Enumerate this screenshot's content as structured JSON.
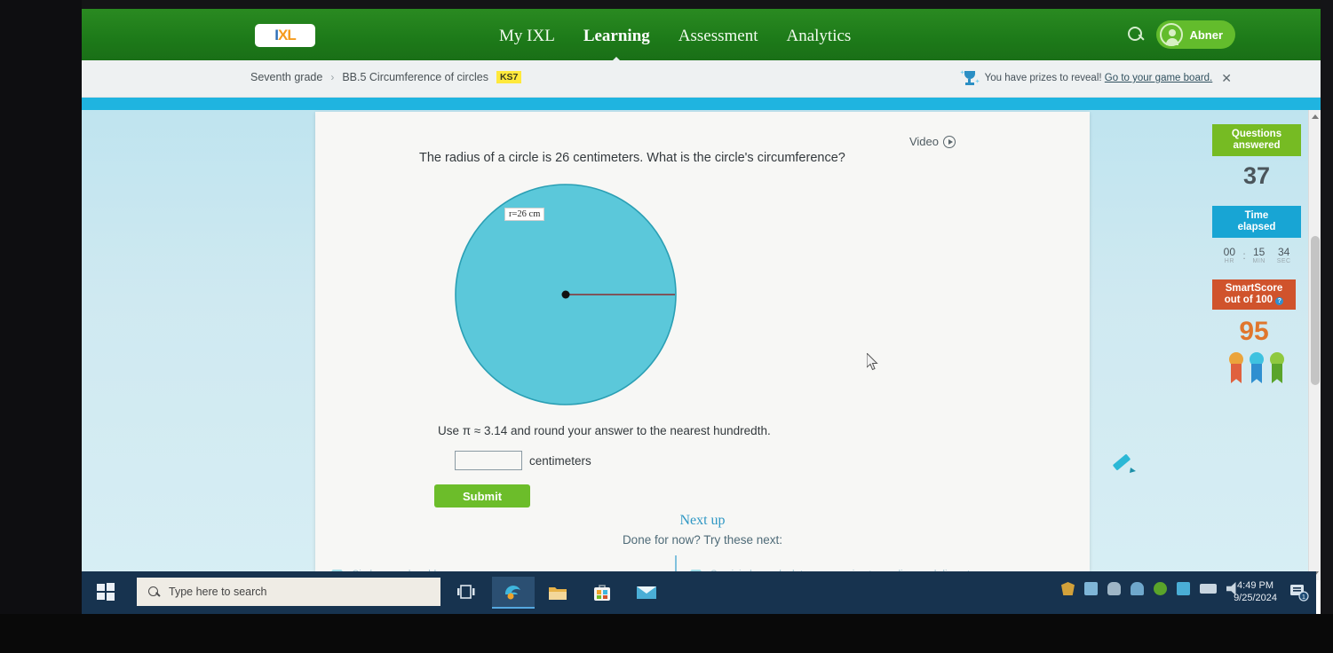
{
  "monitor": {
    "faint_top_text": ""
  },
  "header": {
    "logo": {
      "prefix": "I",
      "mid": "X",
      "suffix": "L"
    },
    "nav": [
      {
        "label": "My IXL",
        "active": false
      },
      {
        "label": "Learning",
        "active": true
      },
      {
        "label": "Assessment",
        "active": false
      },
      {
        "label": "Analytics",
        "active": false
      }
    ],
    "search_icon": "search-icon",
    "user": {
      "name": "Abner"
    },
    "colors": {
      "green": "#1d7a19",
      "pill_green": "#63bc2c"
    }
  },
  "breadcrumb": {
    "grade": "Seventh grade",
    "separator": "›",
    "skill": "BB.5 Circumference of circles",
    "badge": "KS7"
  },
  "prize_banner": {
    "icon": "trophy-icon",
    "message": "You have prizes to reveal!",
    "link": "Go to your game board.",
    "close": "✕"
  },
  "question": {
    "video_label": "Video",
    "prompt": "The radius of a circle is 26 centimeters. What is the circle's circumference?",
    "figure": {
      "type": "circle",
      "radius_label": "r=26 cm",
      "radius_value": 26,
      "unit": "cm",
      "fill": "#5bc8da",
      "stroke": "#2a9fb4",
      "radius_line_color": "#8a2f2f"
    },
    "hint": "Use π ≈ 3.14 and round your answer to the nearest hundredth.",
    "answer_value": "",
    "answer_placeholder": "",
    "answer_unit": "centimeters",
    "submit_label": "Submit",
    "scratchpad_icon": "pencil-icon"
  },
  "next_up": {
    "title": "Next up",
    "subtitle": "Done for now? Try these next:",
    "links": [
      {
        "icon": "gem-icon",
        "label": "Circles: word problems"
      },
      {
        "icon": "gem-icon",
        "label": "Semicircles: calculate area, perimeter, radius, and diameter"
      }
    ]
  },
  "stats": {
    "questions": {
      "title_line1": "Questions",
      "title_line2": "answered",
      "value": "37",
      "color": "#76bb23"
    },
    "time": {
      "title_line1": "Time",
      "title_line2": "elapsed",
      "color": "#18a5d4",
      "hours": "00",
      "minutes": "15",
      "seconds": "34",
      "label_hr": "HR",
      "label_min": "MIN",
      "label_sec": "SEC",
      "colon": ":"
    },
    "smartscore": {
      "title_line1": "SmartScore",
      "title_line2": "out of 100",
      "info_icon": "info-icon",
      "value": "95",
      "color": "#d0532c",
      "value_color": "#e0762d"
    },
    "ribbons": [
      "orange",
      "blue",
      "green"
    ]
  },
  "taskbar": {
    "start_icon": "windows-start-icon",
    "search_placeholder": "Type here to search",
    "task_view_icon": "task-view-icon",
    "apps": [
      {
        "name": "edge-icon",
        "active": true
      },
      {
        "name": "file-explorer-icon",
        "active": false
      },
      {
        "name": "microsoft-store-icon",
        "active": false
      },
      {
        "name": "mail-icon",
        "active": false
      }
    ],
    "tray_icons": [
      "shield-icon",
      "photos-icon",
      "cloud-icon",
      "onedrive-icon",
      "sync-icon",
      "bluetooth-icon",
      "battery-icon",
      "volume-mute-icon"
    ],
    "time": "4:49 PM",
    "date": "9/25/2024",
    "notification_icon": "notification-icon"
  }
}
